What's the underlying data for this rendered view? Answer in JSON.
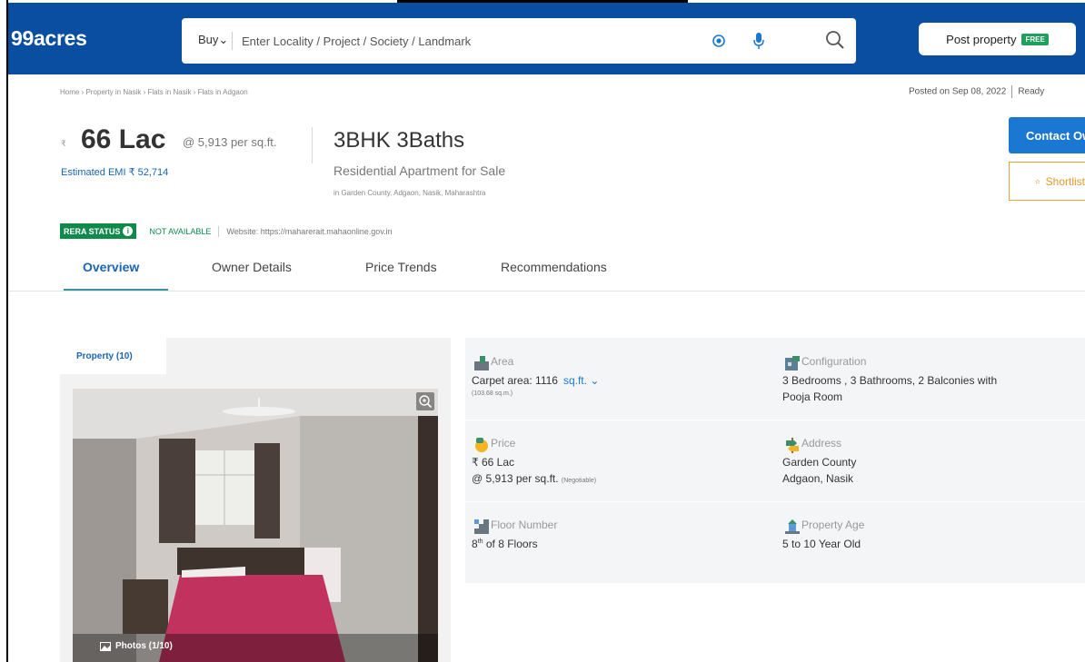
{
  "header": {
    "logo": "99acres",
    "buy_label": "Buy",
    "search_placeholder": "Enter Locality / Project / Society / Landmark",
    "post_property": "Post property",
    "free_badge": "FREE"
  },
  "breadcrumb": "Home › Property in Nasik › Flats in Nasik › Flats in Adgaon",
  "posted": {
    "date": "Posted on Sep 08, 2022",
    "status": "Ready"
  },
  "listing": {
    "rupee_symbol": "₹",
    "price": "66 Lac",
    "price_per_sqft": "@ 5,913 per sq.ft.",
    "emi": "Estimated EMI ₹ 52,714",
    "title": "3BHK 3Baths",
    "subtitle": "Residential Apartment for Sale",
    "location": "in Garden County, Adgaon, Nasik, Maharashtra"
  },
  "actions": {
    "contact": "Contact Owner",
    "shortlist": "Shortlist"
  },
  "rera": {
    "badge": "RERA STATUS",
    "info": "i",
    "status": "NOT AVAILABLE",
    "website": "Website: https://maharerait.mahaonline.gov.in"
  },
  "tabs": [
    {
      "label": "Overview",
      "active": true
    },
    {
      "label": "Owner Details",
      "active": false
    },
    {
      "label": "Price Trends",
      "active": false
    },
    {
      "label": "Recommendations",
      "active": false
    }
  ],
  "gallery": {
    "tab_label": "Property (10)",
    "photos_label": "Photos (1/10)"
  },
  "details": {
    "area": {
      "label": "Area",
      "line1": "Carpet area: 1116",
      "unit": "sq.ft.",
      "line2": "(103.68 sq.m.)"
    },
    "configuration": {
      "label": "Configuration",
      "line1": "3 Bedrooms , 3 Bathrooms, 2 Balconies with",
      "line2": "Pooja Room"
    },
    "price": {
      "label": "Price",
      "line1": "₹ 66 Lac",
      "line2": "@ 5,913 per sq.ft.",
      "negotiable": "(Negotiable)"
    },
    "address": {
      "label": "Address",
      "line1": "Garden County",
      "line2": "Adgaon, Nasik"
    },
    "floor": {
      "label": "Floor Number",
      "floor_num": "8",
      "suffix": "th",
      "line1_rest": "of 8 Floors"
    },
    "age": {
      "label": "Property Age",
      "line1": "5 to 10 Year Old"
    }
  },
  "colors": {
    "brand_blue": "#0a4ea1",
    "rera_green": "#0f8a4b",
    "link_blue": "#1a64b8",
    "accent_orange": "#f0a034"
  }
}
